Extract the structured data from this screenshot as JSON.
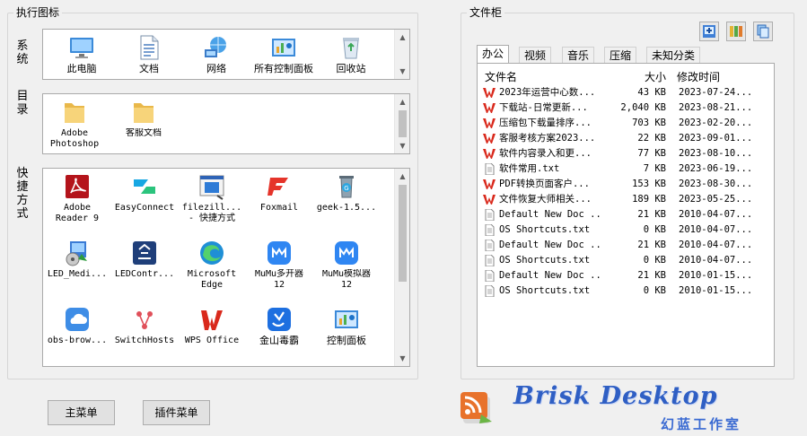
{
  "left_group": {
    "title": "执行图标",
    "system": {
      "label": "系统",
      "items": [
        {
          "label": "此电脑",
          "icon": "computer-icon"
        },
        {
          "label": "文档",
          "icon": "document-icon"
        },
        {
          "label": "网络",
          "icon": "network-icon"
        },
        {
          "label": "所有控制面板",
          "icon": "control-panel-icon"
        },
        {
          "label": "回收站",
          "icon": "recycle-bin-icon"
        }
      ]
    },
    "directory": {
      "label": "目录",
      "items": [
        {
          "label": "Adobe\nPhotoshop",
          "icon": "folder-icon"
        },
        {
          "label": "客服文档",
          "icon": "folder-icon"
        }
      ]
    },
    "shortcuts": {
      "label": "快捷方式",
      "items": [
        {
          "label": "Adobe\nReader 9",
          "icon": "acrobat-icon"
        },
        {
          "label": "EasyConnect",
          "icon": "easyconnect-icon"
        },
        {
          "label": "filezill...\n- 快捷方式",
          "icon": "filezilla-icon"
        },
        {
          "label": "Foxmail",
          "icon": "foxmail-icon"
        },
        {
          "label": "geek-1.5...",
          "icon": "geek-icon"
        },
        {
          "label": "LED_Medi...",
          "icon": "installer-icon"
        },
        {
          "label": "LEDContr...",
          "icon": "ledcontrol-icon"
        },
        {
          "label": "Microsoft\nEdge",
          "icon": "edge-icon"
        },
        {
          "label": "MuMu多开器\n12",
          "icon": "mumu-icon"
        },
        {
          "label": "MuMu模拟器\n12",
          "icon": "mumu-icon"
        },
        {
          "label": "obs-brow...",
          "icon": "cloud-icon"
        },
        {
          "label": "SwitchHosts",
          "icon": "switchhosts-icon"
        },
        {
          "label": "WPS Office",
          "icon": "wps-icon"
        },
        {
          "label": "金山毒霸",
          "icon": "duba-icon"
        },
        {
          "label": "控制面板",
          "icon": "control-panel-icon"
        }
      ]
    }
  },
  "buttons": {
    "main_menu": "主菜单",
    "plugin_menu": "插件菜单"
  },
  "right_group": {
    "title": "文件柜",
    "toolbar": [
      "add-icon",
      "grid-icon",
      "copy-icon"
    ],
    "tabs": [
      "办公",
      "视频",
      "音乐",
      "压缩",
      "未知分类"
    ],
    "active_tab": 0,
    "columns": {
      "name": "文件名",
      "size": "大小",
      "modified": "修改时间"
    },
    "files": [
      {
        "name": "2023年运营中心数...",
        "size": "43 KB",
        "date": "2023-07-24...",
        "type": "wps"
      },
      {
        "name": "下载站-日常更新...",
        "size": "2,040 KB",
        "date": "2023-08-21...",
        "type": "wps"
      },
      {
        "name": "压缩包下载量排序...",
        "size": "703 KB",
        "date": "2023-02-20...",
        "type": "wps"
      },
      {
        "name": "客服考核方案2023...",
        "size": "22 KB",
        "date": "2023-09-01...",
        "type": "wps"
      },
      {
        "name": "软件内容录入和更...",
        "size": "77 KB",
        "date": "2023-08-10...",
        "type": "wps"
      },
      {
        "name": "软件常用.txt",
        "size": "7 KB",
        "date": "2023-06-19...",
        "type": "txt"
      },
      {
        "name": "PDF转换页面客户...",
        "size": "153 KB",
        "date": "2023-08-30...",
        "type": "wps"
      },
      {
        "name": "文件恢复大师相关...",
        "size": "189 KB",
        "date": "2023-05-25...",
        "type": "wps"
      },
      {
        "name": "Default New Doc ...",
        "size": "21 KB",
        "date": "2010-04-07...",
        "type": "txt"
      },
      {
        "name": "OS Shortcuts.txt",
        "size": "0 KB",
        "date": "2010-04-07...",
        "type": "txt"
      },
      {
        "name": "Default New Doc ...",
        "size": "21 KB",
        "date": "2010-04-07...",
        "type": "txt"
      },
      {
        "name": "OS Shortcuts.txt",
        "size": "0 KB",
        "date": "2010-04-07...",
        "type": "txt"
      },
      {
        "name": "Default New Doc ...",
        "size": "21 KB",
        "date": "2010-01-15...",
        "type": "txt"
      },
      {
        "name": "OS Shortcuts.txt",
        "size": "0 KB",
        "date": "2010-01-15...",
        "type": "txt"
      }
    ]
  },
  "branding": {
    "logo_icon": "rss-logo-icon",
    "title": "Brisk Desktop",
    "subtitle": "幻蓝工作室"
  },
  "colors": {
    "accent": "#2f5fc4",
    "wps_red": "#d9291c",
    "panel_bg": "#ffffff",
    "window_bg": "#f0f0f0"
  }
}
